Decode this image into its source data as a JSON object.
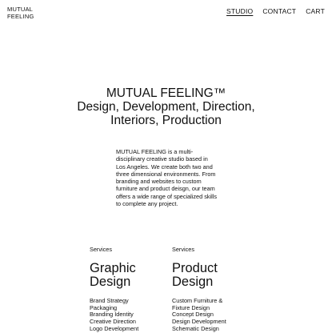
{
  "brand": {
    "line1": "MUTUAL",
    "line2": "FEELING"
  },
  "nav": {
    "items": [
      "STUDIO",
      "CONTACT",
      "CART"
    ]
  },
  "hero": {
    "line1": "MUTUAL FEELING™",
    "line2": "Design, Development, Direction,",
    "line3": "Interiors, Production"
  },
  "intro": {
    "text": "MUTUAL FEELING is a multi-disciplinary creative studio based in Los Angeles. We create both two and three dimensional environments. From branding and websites to custom furniture and product deisgn, our team offers a wide range of specialized skills to complete any project."
  },
  "services": [
    {
      "label": "Services",
      "heading_line1": "Graphic",
      "heading_line2": "Design",
      "items": [
        "Brand Strategy",
        "Packaging",
        "Branding Identity",
        "Creative Direction",
        "Logo Development"
      ]
    },
    {
      "label": "Services",
      "heading_line1": "Product",
      "heading_line2": "Design",
      "items": [
        "Custom Furniture &",
        "Fixture Design",
        "Concept Design",
        "Design Development",
        "Schematic Design"
      ]
    }
  ]
}
